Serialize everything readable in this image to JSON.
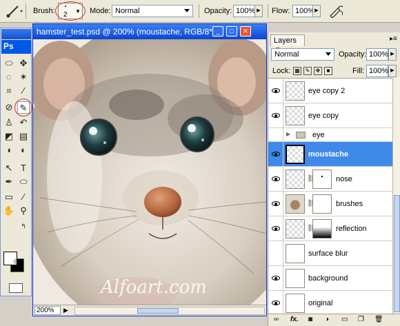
{
  "options_bar": {
    "brush_label": "Brush:",
    "brush_size": "2",
    "mode_label": "Mode:",
    "mode_value": "Normal",
    "opacity_label": "Opacity:",
    "opacity_value": "100%",
    "flow_label": "Flow:",
    "flow_value": "100%"
  },
  "toolbox": {
    "badge": "Ps",
    "icons": [
      "marquee-icon",
      "move-icon",
      "lasso-icon",
      "magic-wand-icon",
      "crop-icon",
      "slice-icon",
      "healing-icon",
      "brush-icon",
      "stamp-icon",
      "history-brush-icon",
      "eraser-icon",
      "gradient-icon",
      "blur-icon",
      "dodge-icon",
      "path-select-icon",
      "type-icon",
      "pen-icon",
      "shape-icon",
      "notes-icon",
      "eyedropper-icon",
      "hand-icon",
      "zoom-icon"
    ]
  },
  "document": {
    "title": "hamster_test.psd @ 200% (moustache, RGB/8*)",
    "zoom": "200%",
    "watermark": "Alfoart.com"
  },
  "layers_panel": {
    "tab_label": "Layers",
    "tab_close": "×",
    "blend_mode": "Normal",
    "opacity_label": "Opacity:",
    "opacity_value": "100%",
    "lock_label": "Lock:",
    "fill_label": "Fill:",
    "fill_value": "100%",
    "layers": [
      {
        "name": "eye copy 2",
        "visible": true,
        "thumb": "transparent"
      },
      {
        "name": "eye copy",
        "visible": true,
        "thumb": "transparent"
      },
      {
        "name": "eye",
        "visible": false,
        "thumb": "group"
      },
      {
        "name": "moustache",
        "visible": true,
        "thumb": "transparent",
        "selected": true
      },
      {
        "name": "nose",
        "visible": true,
        "thumb": "transparent",
        "mask": "dot"
      },
      {
        "name": "brushes",
        "visible": true,
        "thumb": "photo",
        "mask": "white"
      },
      {
        "name": "reflection",
        "visible": true,
        "thumb": "transparent",
        "mask": "gradient"
      },
      {
        "name": "surface blur",
        "visible": false,
        "thumb": "photo"
      },
      {
        "name": "background",
        "visible": true,
        "thumb": "white"
      },
      {
        "name": "original",
        "visible": true,
        "thumb": "photo"
      }
    ],
    "footer_icons": [
      "link-icon",
      "fx-icon",
      "mask-icon",
      "adjustment-icon",
      "folder-icon",
      "new-layer-icon",
      "trash-icon"
    ]
  },
  "colors": {
    "selection": "#3f89e8",
    "titlebar": "#0a46d2",
    "annotation": "#d9343a"
  }
}
